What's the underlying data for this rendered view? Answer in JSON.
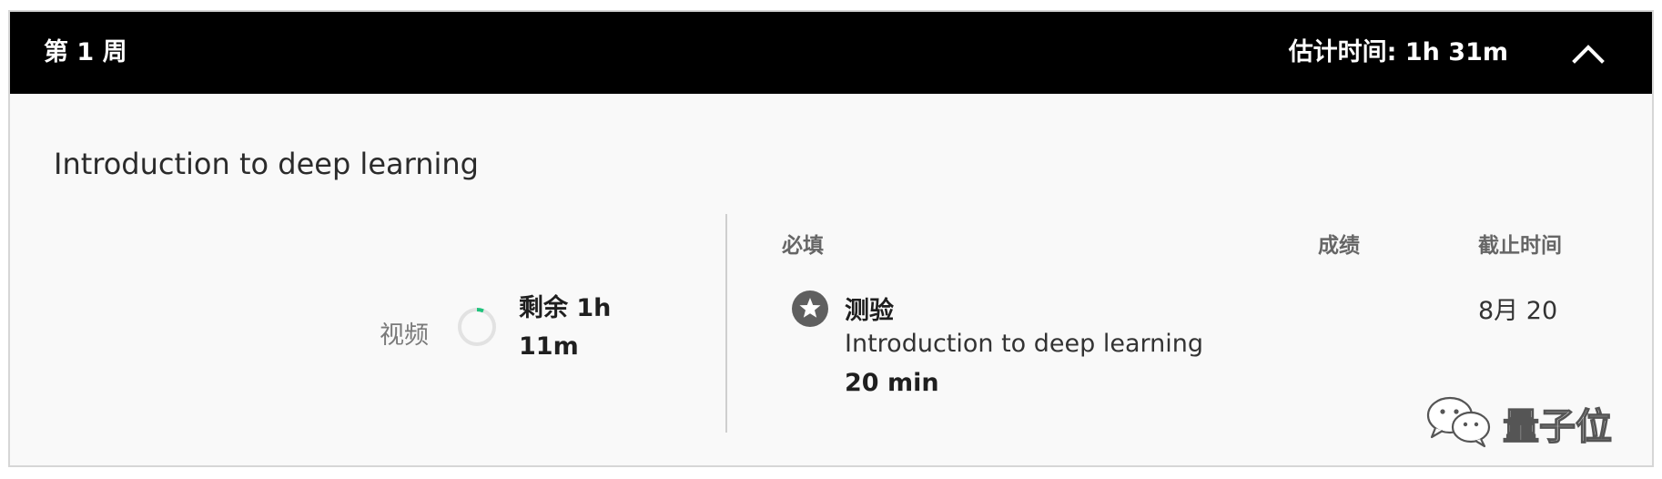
{
  "week": {
    "title": "第 1 周",
    "estimate": "估计时间: 1h 31m",
    "collapse_icon": "chevron-up-icon"
  },
  "module": {
    "title": "Introduction to deep learning",
    "video_label": "视频",
    "video_progress": 0.06,
    "remaining_line1": "剩余 1h",
    "remaining_line2": "11m"
  },
  "columns": {
    "required": "必填",
    "grade": "成绩",
    "deadline": "截止时间"
  },
  "items": [
    {
      "icon": "star-icon",
      "type": "测验",
      "name": "Introduction to deep learning",
      "duration": "20 min",
      "due": "8月 20"
    }
  ],
  "watermark": {
    "text": "量子位",
    "icon": "wechat-icon"
  },
  "colors": {
    "header_bg": "#000000",
    "progress_accent": "#1fc37c",
    "icon_gray": "#5f5f5f"
  }
}
